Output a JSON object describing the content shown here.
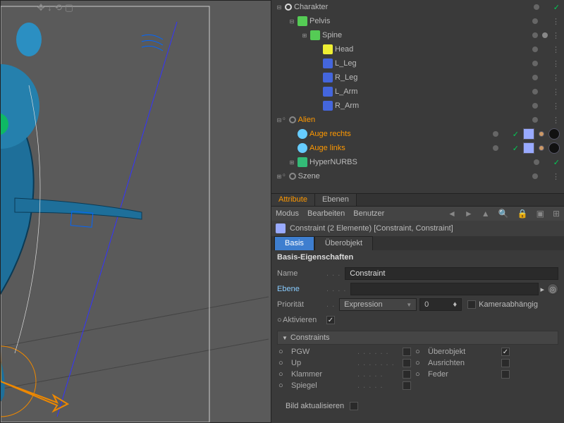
{
  "hierarchy": [
    {
      "name": "Charakter",
      "indent": 0,
      "exp": "minus",
      "icon": "#ddd",
      "iconShape": "null",
      "hasCheck": true
    },
    {
      "name": "Pelvis",
      "indent": 1,
      "exp": "minus",
      "icon": "#5c5",
      "iconShape": "joint"
    },
    {
      "name": "Spine",
      "indent": 2,
      "exp": "plus",
      "icon": "#5c5",
      "iconShape": "joint",
      "dotR": true
    },
    {
      "name": "Head",
      "indent": 3,
      "exp": "",
      "icon": "#ee3",
      "iconShape": "joint"
    },
    {
      "name": "L_Leg",
      "indent": 3,
      "exp": "",
      "icon": "#46d",
      "iconShape": "joint"
    },
    {
      "name": "R_Leg",
      "indent": 3,
      "exp": "",
      "icon": "#46d",
      "iconShape": "joint"
    },
    {
      "name": "L_Arm",
      "indent": 3,
      "exp": "",
      "icon": "#46d",
      "iconShape": "joint"
    },
    {
      "name": "R_Arm",
      "indent": 3,
      "exp": "",
      "icon": "#46d",
      "iconShape": "joint"
    },
    {
      "name": "Alien",
      "indent": 0,
      "exp": "minus",
      "icon": "#888",
      "iconShape": "null",
      "sel": true,
      "lvl": true
    },
    {
      "name": "Auge rechts",
      "indent": 1,
      "exp": "",
      "icon": "#6cf",
      "iconShape": "sphere",
      "sel": true,
      "hasCheck": true,
      "tags": true
    },
    {
      "name": "Auge links",
      "indent": 1,
      "exp": "",
      "icon": "#6cf",
      "iconShape": "sphere",
      "sel": true,
      "hasCheck": true,
      "tags": true
    },
    {
      "name": "HyperNURBS",
      "indent": 1,
      "exp": "plus",
      "icon": "#3b7",
      "iconShape": "hnurbs",
      "hasCheck": true
    },
    {
      "name": "Szene",
      "indent": 0,
      "exp": "plus",
      "icon": "#888",
      "iconShape": "null",
      "lvl": true
    }
  ],
  "tabs": {
    "attribute": "Attribute",
    "ebenen": "Ebenen"
  },
  "menu": {
    "modus": "Modus",
    "bearbeiten": "Bearbeiten",
    "benutzer": "Benutzer"
  },
  "obj": {
    "title": "Constraint (2 Elemente) [Constraint, Constraint]"
  },
  "subtabs": {
    "basis": "Basis",
    "ueber": "Überobjekt"
  },
  "section": "Basis-Eigenschaften",
  "props": {
    "name": {
      "label": "Name",
      "value": "Constraint"
    },
    "ebene": {
      "label": "Ebene",
      "value": ""
    },
    "prio": {
      "label": "Priorität",
      "value": "Expression",
      "num": "0"
    },
    "kamera": {
      "label": "Kameraabhängig"
    },
    "akt": {
      "label": "Aktivieren"
    }
  },
  "constraints": {
    "title": "Constraints",
    "pgw": "PGW",
    "ueber": "Überobjekt",
    "up": "Up",
    "aus": "Ausrichten",
    "klammer": "Klammer",
    "feder": "Feder",
    "spiegel": "Spiegel",
    "bild": "Bild aktualisieren"
  }
}
